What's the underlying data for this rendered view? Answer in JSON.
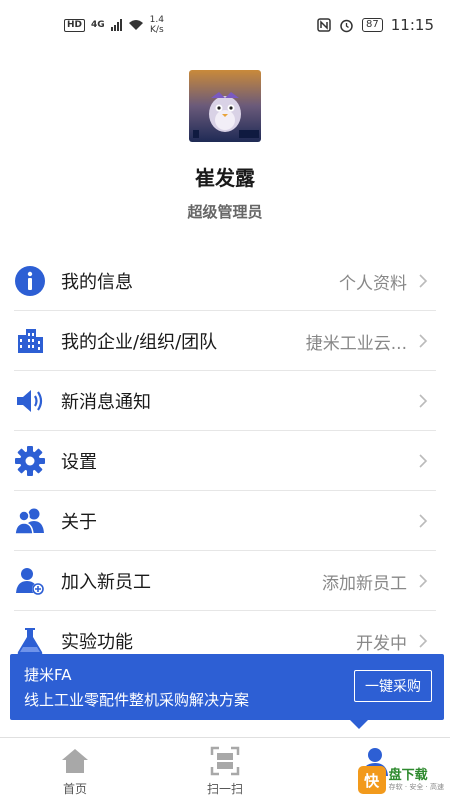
{
  "status_bar": {
    "hd": "HD",
    "network": "4G",
    "speed_value": "1.4",
    "speed_unit": "K/s",
    "battery": "87",
    "time": "11:15"
  },
  "profile": {
    "name": "崔发露",
    "role": "超级管理员"
  },
  "menu": {
    "items": [
      {
        "label": "我的信息",
        "value": "个人资料",
        "icon": "info-icon"
      },
      {
        "label": "我的企业/组织/团队",
        "value": "捷米工业云...",
        "icon": "building-icon"
      },
      {
        "label": "新消息通知",
        "value": "",
        "icon": "speaker-icon"
      },
      {
        "label": "设置",
        "value": "",
        "icon": "gear-icon"
      },
      {
        "label": "关于",
        "value": "",
        "icon": "users-icon"
      },
      {
        "label": "加入新员工",
        "value": "添加新员工",
        "icon": "add-user-icon"
      },
      {
        "label": "实验功能",
        "value": "开发中",
        "icon": "flask-icon"
      }
    ]
  },
  "banner": {
    "title": "捷米FA",
    "subtitle": "线上工业零配件整机采购解决方案",
    "button": "一键采购",
    "color": "#2d5fd4"
  },
  "tabbar": {
    "tabs": [
      {
        "label": "首页",
        "icon": "home-icon"
      },
      {
        "label": "扫一扫",
        "icon": "scan-icon"
      },
      {
        "label": "",
        "icon": "profile-icon"
      }
    ]
  },
  "watermark": {
    "badge": "快",
    "title": "盘下载",
    "sub": "存软 · 安全 · 高速"
  },
  "colors": {
    "accent": "#2d5fd4",
    "icon_blue": "#2d5fd4"
  }
}
